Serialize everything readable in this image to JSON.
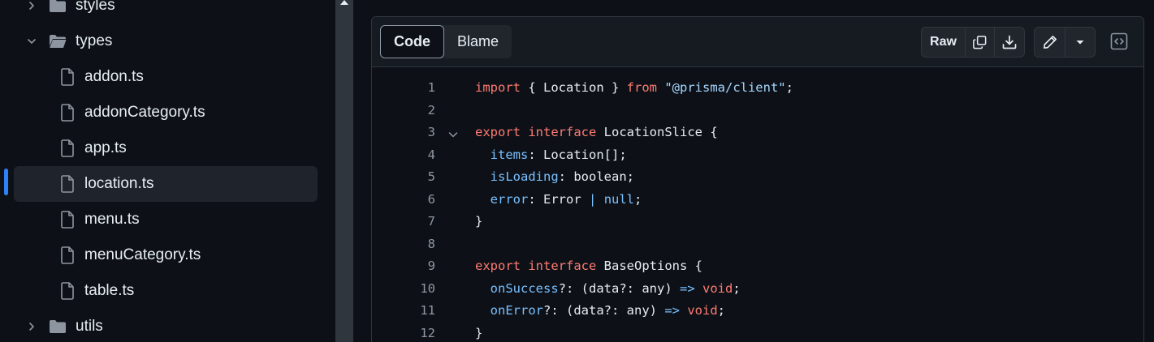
{
  "sidebar": {
    "items": [
      {
        "label": "styles",
        "kind": "folder",
        "expanded": false
      },
      {
        "label": "types",
        "kind": "folder",
        "expanded": true
      },
      {
        "label": "addon.ts",
        "kind": "file"
      },
      {
        "label": "addonCategory.ts",
        "kind": "file"
      },
      {
        "label": "app.ts",
        "kind": "file"
      },
      {
        "label": "location.ts",
        "kind": "file",
        "active": true
      },
      {
        "label": "menu.ts",
        "kind": "file"
      },
      {
        "label": "menuCategory.ts",
        "kind": "file"
      },
      {
        "label": "table.ts",
        "kind": "file"
      },
      {
        "label": "utils",
        "kind": "folder",
        "expanded": false
      }
    ]
  },
  "toolbar": {
    "code_tab": "Code",
    "blame_tab": "Blame",
    "raw_label": "Raw",
    "icons": [
      "copy-icon",
      "download-icon",
      "pencil-icon",
      "triangle-down-icon",
      "code-square-icon"
    ]
  },
  "colors": {
    "keyword": "#ff7b72",
    "string": "#a5d6ff",
    "property": "#79c0ff",
    "text": "#e6edf3",
    "line_number": "#8d96a0",
    "accent": "#2f81f7"
  },
  "code": {
    "lines": [
      {
        "n": "1",
        "tokens": [
          {
            "t": "import",
            "c": "kw"
          },
          {
            "t": " { Location } ",
            "c": "plain"
          },
          {
            "t": "from",
            "c": "kw"
          },
          {
            "t": " ",
            "c": "plain"
          },
          {
            "t": "\"@prisma/client\"",
            "c": "str"
          },
          {
            "t": ";",
            "c": "plain"
          }
        ]
      },
      {
        "n": "2",
        "tokens": []
      },
      {
        "n": "3",
        "fold": true,
        "tokens": [
          {
            "t": "export",
            "c": "kw"
          },
          {
            "t": " ",
            "c": "plain"
          },
          {
            "t": "interface",
            "c": "kw"
          },
          {
            "t": " LocationSlice {",
            "c": "plain"
          }
        ]
      },
      {
        "n": "4",
        "tokens": [
          {
            "t": "  ",
            "c": "plain"
          },
          {
            "t": "items",
            "c": "prop"
          },
          {
            "t": ": Location[];",
            "c": "plain"
          }
        ]
      },
      {
        "n": "5",
        "tokens": [
          {
            "t": "  ",
            "c": "plain"
          },
          {
            "t": "isLoading",
            "c": "prop"
          },
          {
            "t": ": boolean;",
            "c": "plain"
          }
        ]
      },
      {
        "n": "6",
        "tokens": [
          {
            "t": "  ",
            "c": "plain"
          },
          {
            "t": "error",
            "c": "prop"
          },
          {
            "t": ": Error ",
            "c": "plain"
          },
          {
            "t": "|",
            "c": "prop"
          },
          {
            "t": " ",
            "c": "plain"
          },
          {
            "t": "null",
            "c": "prop"
          },
          {
            "t": ";",
            "c": "plain"
          }
        ]
      },
      {
        "n": "7",
        "tokens": [
          {
            "t": "}",
            "c": "plain"
          }
        ]
      },
      {
        "n": "8",
        "tokens": []
      },
      {
        "n": "9",
        "tokens": [
          {
            "t": "export",
            "c": "kw"
          },
          {
            "t": " ",
            "c": "plain"
          },
          {
            "t": "interface",
            "c": "kw"
          },
          {
            "t": " BaseOptions {",
            "c": "plain"
          }
        ]
      },
      {
        "n": "10",
        "tokens": [
          {
            "t": "  ",
            "c": "plain"
          },
          {
            "t": "onSuccess",
            "c": "prop"
          },
          {
            "t": "?: (data?: any) ",
            "c": "plain"
          },
          {
            "t": "=>",
            "c": "prop"
          },
          {
            "t": " ",
            "c": "plain"
          },
          {
            "t": "void",
            "c": "kw"
          },
          {
            "t": ";",
            "c": "plain"
          }
        ]
      },
      {
        "n": "11",
        "tokens": [
          {
            "t": "  ",
            "c": "plain"
          },
          {
            "t": "onError",
            "c": "prop"
          },
          {
            "t": "?: (data?: any) ",
            "c": "plain"
          },
          {
            "t": "=>",
            "c": "prop"
          },
          {
            "t": " ",
            "c": "plain"
          },
          {
            "t": "void",
            "c": "kw"
          },
          {
            "t": ";",
            "c": "plain"
          }
        ]
      },
      {
        "n": "12",
        "tokens": [
          {
            "t": "}",
            "c": "plain"
          }
        ]
      }
    ]
  }
}
